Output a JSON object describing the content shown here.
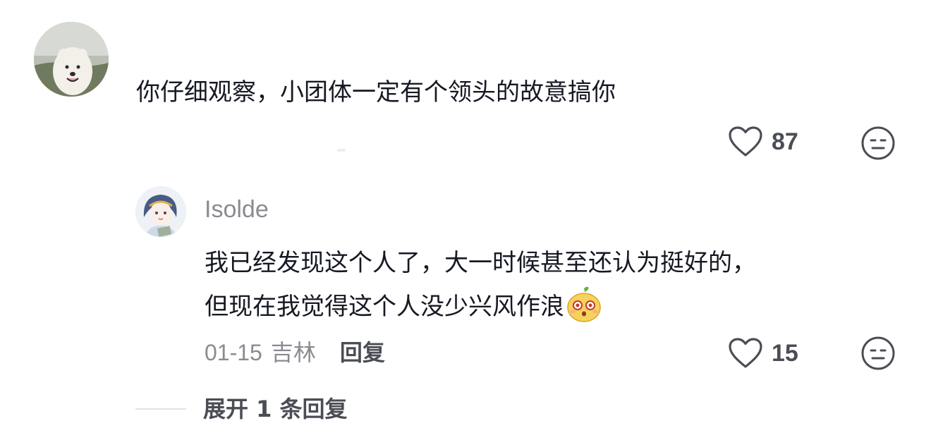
{
  "comment": {
    "text": "你仔细观察，小团体一定有个领头的故意搞你",
    "like_count": "87",
    "avatar_icon": "dog-avatar",
    "like_icon": "heart-outline-icon",
    "dislike_icon": "meh-face-icon"
  },
  "reply": {
    "author": "Isolde",
    "text_line1": "我已经发现这个人了，大一时候甚至还认为挺好的，",
    "text_line2": "但现在我觉得这个人没少兴风作浪",
    "emoji": "surprised-mango-emoji",
    "date": "01-15",
    "location": "吉林",
    "reply_label": "回复",
    "like_count": "15",
    "avatar_icon": "anime-girl-avatar"
  },
  "expand": {
    "label": "展开 1 条回复"
  },
  "colors": {
    "text_primary": "#161823",
    "text_secondary": "#8a8b91",
    "text_action": "#4b4d55",
    "icon_stroke": "#4b4d55"
  }
}
